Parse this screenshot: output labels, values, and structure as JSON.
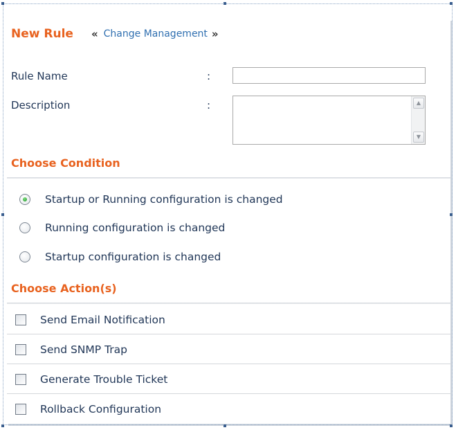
{
  "header": {
    "title": "New Rule",
    "breadcrumb_left": "«",
    "breadcrumb_link": "Change Management",
    "breadcrumb_right": "»"
  },
  "form": {
    "rule_name_label": "Rule Name",
    "description_label": "Description",
    "colon": ":",
    "rule_name_value": "",
    "description_value": ""
  },
  "conditions": {
    "title": "Choose Condition",
    "options": [
      {
        "label": "Startup or Running configuration is changed",
        "checked": true
      },
      {
        "label": "Running configuration is changed",
        "checked": false
      },
      {
        "label": "Startup configuration is changed",
        "checked": false
      }
    ]
  },
  "actions": {
    "title": "Choose Action(s)",
    "options": [
      {
        "label": "Send Email Notification",
        "checked": false
      },
      {
        "label": "Send SNMP Trap",
        "checked": false
      },
      {
        "label": "Generate Trouble Ticket",
        "checked": false
      },
      {
        "label": "Rollback Configuration",
        "checked": false
      }
    ]
  },
  "colors": {
    "accent": "#e8621f",
    "link": "#2f6fb0",
    "text": "#1f3556",
    "radio_selected": "#1e8f2a"
  },
  "icons": {
    "scroll_up": "scroll-up-arrow-icon",
    "scroll_down": "scroll-down-arrow-icon"
  }
}
